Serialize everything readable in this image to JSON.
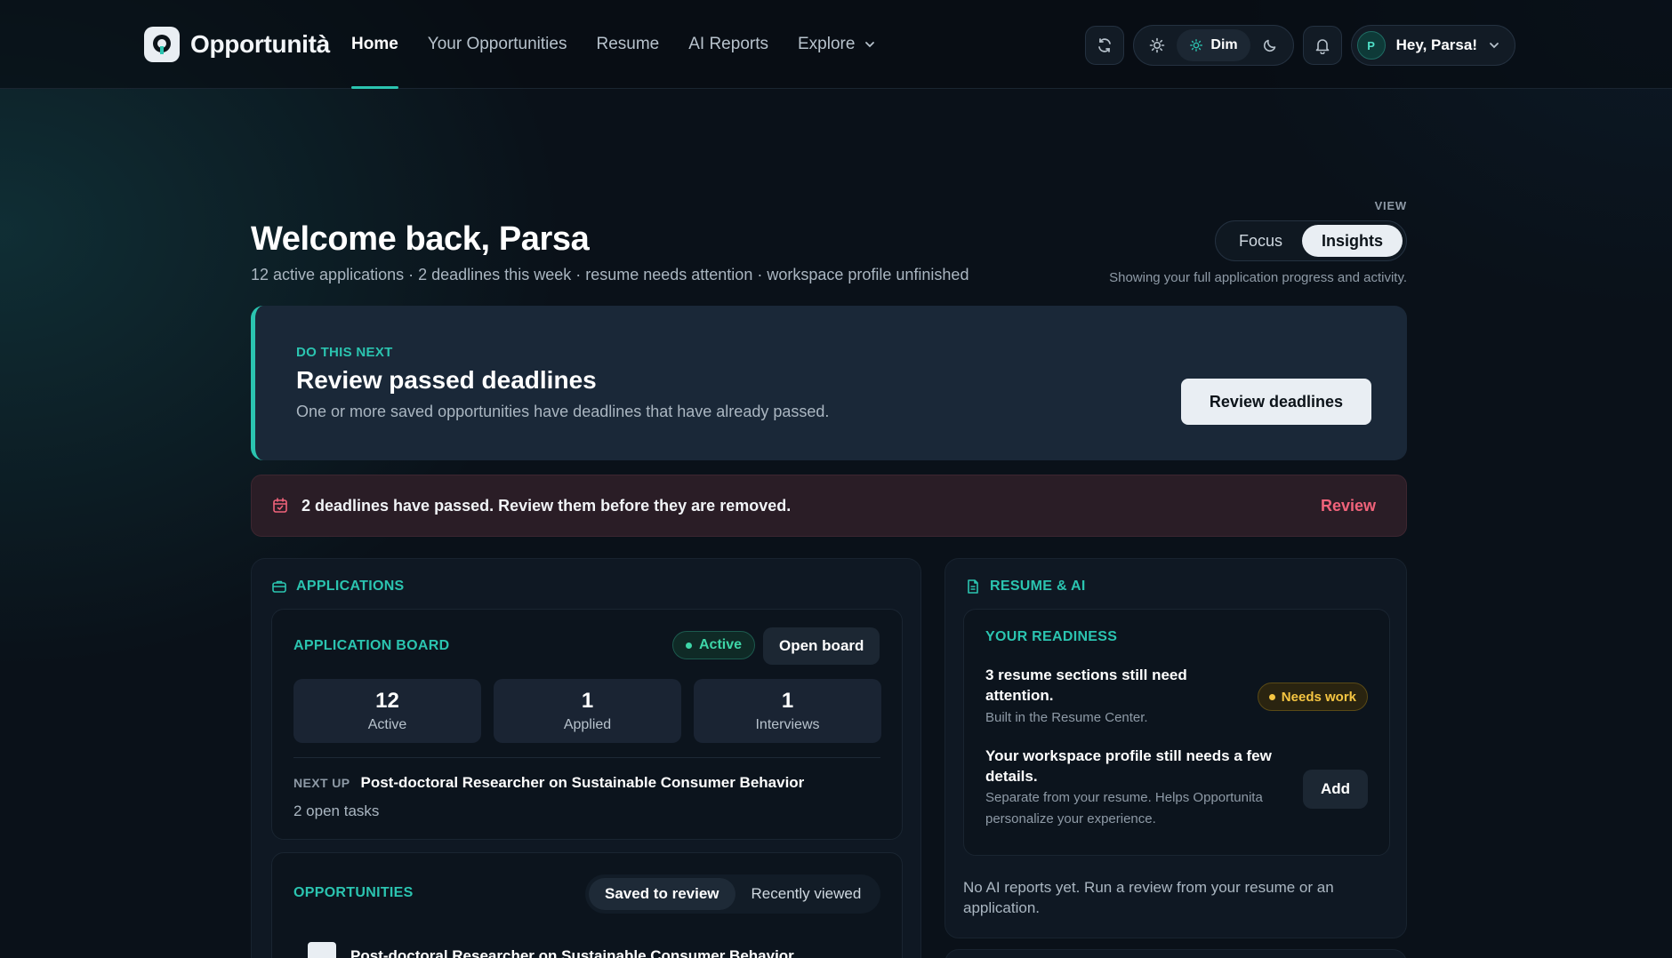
{
  "nav": {
    "brand": "Opportunità",
    "links": [
      {
        "label": "Home",
        "active": true
      },
      {
        "label": "Your Opportunities"
      },
      {
        "label": "Resume"
      },
      {
        "label": "AI Reports"
      },
      {
        "label": "Explore",
        "has_dropdown": true
      }
    ],
    "theme_options": [
      "light",
      "Dim",
      "dark"
    ],
    "theme_active": "Dim",
    "user_initial": "P",
    "user_greeting": "Hey, Parsa!",
    "icons": [
      "refresh-icon",
      "sun-icon",
      "moon-icon",
      "bell-icon",
      "chevron-down-icon"
    ]
  },
  "header": {
    "title": "Welcome back, Parsa",
    "summary": "12 active applications · 2 deadlines this week · resume needs attention · workspace profile unfinished",
    "view_label": "VIEW",
    "view_options": [
      "Focus",
      "Insights"
    ],
    "view_active": "Insights",
    "view_desc": "Showing your full application progress and activity."
  },
  "next_action": {
    "eyebrow": "DO THIS NEXT",
    "title": "Review passed deadlines",
    "desc": "One or more saved opportunities have deadlines that have already passed.",
    "button": "Review deadlines",
    "accent": "#2bc4b0"
  },
  "alert": {
    "text": "2 deadlines have passed. Review them before they are removed.",
    "link": "Review",
    "color": "#f0637a"
  },
  "applications": {
    "heading": "APPLICATIONS",
    "board": {
      "title": "APPLICATION BOARD",
      "status": "Active",
      "open_button": "Open board",
      "stats": [
        {
          "value": "12",
          "label": "Active"
        },
        {
          "value": "1",
          "label": "Applied"
        },
        {
          "value": "1",
          "label": "Interviews"
        }
      ],
      "next_up_label": "NEXT UP",
      "next_up_title": "Post-doctoral Researcher on Sustainable Consumer Behavior",
      "open_tasks": "2 open tasks"
    },
    "opportunities": {
      "title": "OPPORTUNITIES",
      "tabs": [
        "Saved to review",
        "Recently viewed"
      ],
      "active_tab": "Saved to review",
      "items": [
        {
          "title": "Post-doctoral Researcher on Sustainable Consumer Behavior"
        }
      ]
    }
  },
  "resume_ai": {
    "heading": "RESUME & AI",
    "readiness_title": "YOUR READINESS",
    "resume_item": {
      "title": "3 resume sections still need attention.",
      "desc": "Built in the Resume Center.",
      "badge": "Needs work"
    },
    "profile_item": {
      "title": "Your workspace profile still needs a few details.",
      "desc": "Separate from your resume. Helps Opportunita personalize your experience.",
      "button": "Add"
    },
    "no_reports": "No AI reports yet. Run a review from your resume or an application."
  }
}
